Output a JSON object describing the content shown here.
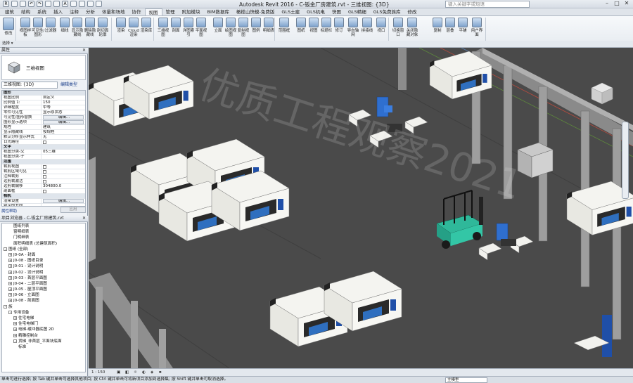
{
  "window": {
    "title": "Autodesk Revit 2016 -    C-钣金厂房建筑.rvt - 三维视图: {3D}",
    "search_placeholder": "键入关键字或短语"
  },
  "tabs": [
    "建筑",
    "结构",
    "系统",
    "插入",
    "注释",
    "分析",
    "体量和场地",
    "协作",
    "视图",
    "管理",
    "附加模块",
    "BIM数据库",
    "橄榄山快模-免费版",
    "GLS土建",
    "GLS机电",
    "快图",
    "GLS精细",
    "GLS免费族库",
    "修改"
  ],
  "active_tab": "视图",
  "ribbon": {
    "buttons": [
      "修改",
      "视图样板",
      "可见性/图形",
      "过滤器",
      "细线",
      "显示隐藏线",
      "删除隐藏线",
      "剖切面轮廓",
      "渲染",
      "Cloud渲染",
      "渲染库",
      "三维视图",
      "剖面",
      "详图索引",
      "平面视图",
      "立面",
      "绘图视图",
      "复制视图",
      "图例",
      "明细表",
      "范围框",
      "图纸",
      "视图",
      "标题栏",
      "修订",
      "导向轴网",
      "拼接线",
      "视口",
      "切换窗口",
      "关闭隐藏对象",
      "复制",
      "层叠",
      "平铺",
      "用户界面"
    ],
    "groups": [
      "选择",
      "图形",
      "演示",
      "创建",
      "图纸组合",
      "窗口"
    ]
  },
  "options_bar": {
    "select_label": "选择 ▾"
  },
  "properties": {
    "header": "属性",
    "type_name": "三维视图",
    "selector": "三维视图: {3D}",
    "edit_type": "编辑类型",
    "rows": [
      {
        "k": "图形",
        "v": "",
        "sec": true
      },
      {
        "k": "视图比例",
        "v": "自定义"
      },
      {
        "k": "比例值 1:",
        "v": "150"
      },
      {
        "k": "详细程度",
        "v": "中等"
      },
      {
        "k": "零件可见性",
        "v": "显示原状态"
      },
      {
        "k": "可见性/图形替换",
        "v": "编辑...",
        "btn": true
      },
      {
        "k": "图形显示选项",
        "v": "编辑...",
        "btn": true
      },
      {
        "k": "规程",
        "v": "建筑"
      },
      {
        "k": "显示隐藏线",
        "v": "按规程"
      },
      {
        "k": "默认分析显示样式",
        "v": "无"
      },
      {
        "k": "日光路径",
        "v": "",
        "chk": true
      },
      {
        "k": "文字",
        "v": "",
        "sec": true
      },
      {
        "k": "视图分类-父",
        "v": "05三维"
      },
      {
        "k": "视图分类-子",
        "v": ""
      },
      {
        "k": "范围",
        "v": "",
        "sec": true
      },
      {
        "k": "裁剪视图",
        "v": "",
        "chk": true
      },
      {
        "k": "裁剪区域可见",
        "v": "",
        "chk": true
      },
      {
        "k": "注释裁剪",
        "v": "",
        "chk": true
      },
      {
        "k": "远剪裁激活",
        "v": "",
        "chk": true
      },
      {
        "k": "远剪裁偏移",
        "v": "304800.0"
      },
      {
        "k": "剖面框",
        "v": "",
        "chk": true
      },
      {
        "k": "相机",
        "v": "",
        "sec": true
      },
      {
        "k": "渲染设置",
        "v": "编辑...",
        "btn": true
      },
      {
        "k": "锁定的方向",
        "v": ""
      }
    ],
    "help": "属性帮助",
    "apply": "应用"
  },
  "project_browser": {
    "header": "项目浏览器 - C-钣金厂房建筑.rvt",
    "nodes": [
      {
        "t": "图纸列表",
        "d": 2
      },
      {
        "t": "窗明细表",
        "d": 2
      },
      {
        "t": "门明细表",
        "d": 2
      },
      {
        "t": "面积明细表 (总建筑面积)",
        "d": 2
      },
      {
        "t": "图纸 (全部)",
        "d": 0,
        "tg": "-"
      },
      {
        "t": "J0-0A - 封面",
        "d": 1,
        "tg": "+"
      },
      {
        "t": "J0-08 - 图纸目录",
        "d": 1,
        "tg": "+"
      },
      {
        "t": "J0-01 - 设计说明",
        "d": 1,
        "tg": "+"
      },
      {
        "t": "J0-02 - 设计说明",
        "d": 1,
        "tg": "+"
      },
      {
        "t": "J0-03 - 首层平面图",
        "d": 1,
        "tg": "+"
      },
      {
        "t": "J0-04 - 二层平面图",
        "d": 1,
        "tg": "+"
      },
      {
        "t": "J0-05 - 屋顶平面图",
        "d": 1,
        "tg": "+"
      },
      {
        "t": "J0-06 - 立面图",
        "d": 1,
        "tg": "+"
      },
      {
        "t": "J0-08 - 剖面图",
        "d": 1,
        "tg": "+"
      },
      {
        "t": "族",
        "d": 0,
        "tg": "-"
      },
      {
        "t": "专用设备",
        "d": 1,
        "tg": "-"
      },
      {
        "t": "住宅电梯",
        "d": 2,
        "tg": "+"
      },
      {
        "t": "住宅电梯门",
        "d": 2,
        "tg": "+"
      },
      {
        "t": "电梯-缓冲器底图 2D",
        "d": 2,
        "tg": "+"
      },
      {
        "t": "精雕控制台",
        "d": 2,
        "tg": "+"
      },
      {
        "t": "货梯_非首层_平面块底面",
        "d": 2,
        "tg": "-"
      },
      {
        "t": "标准",
        "d": 3
      }
    ]
  },
  "view_control": {
    "scale": "1 : 150"
  },
  "status": {
    "text": "单击可进行选择; 按 Tab 键并单击可选择其他项目; 按 Ctrl 键并单击可将新项目添加到选择集; 按 Shift 键并单击可取消选择。",
    "workset": "主模型"
  },
  "watermark": "优质工程观察2021"
}
